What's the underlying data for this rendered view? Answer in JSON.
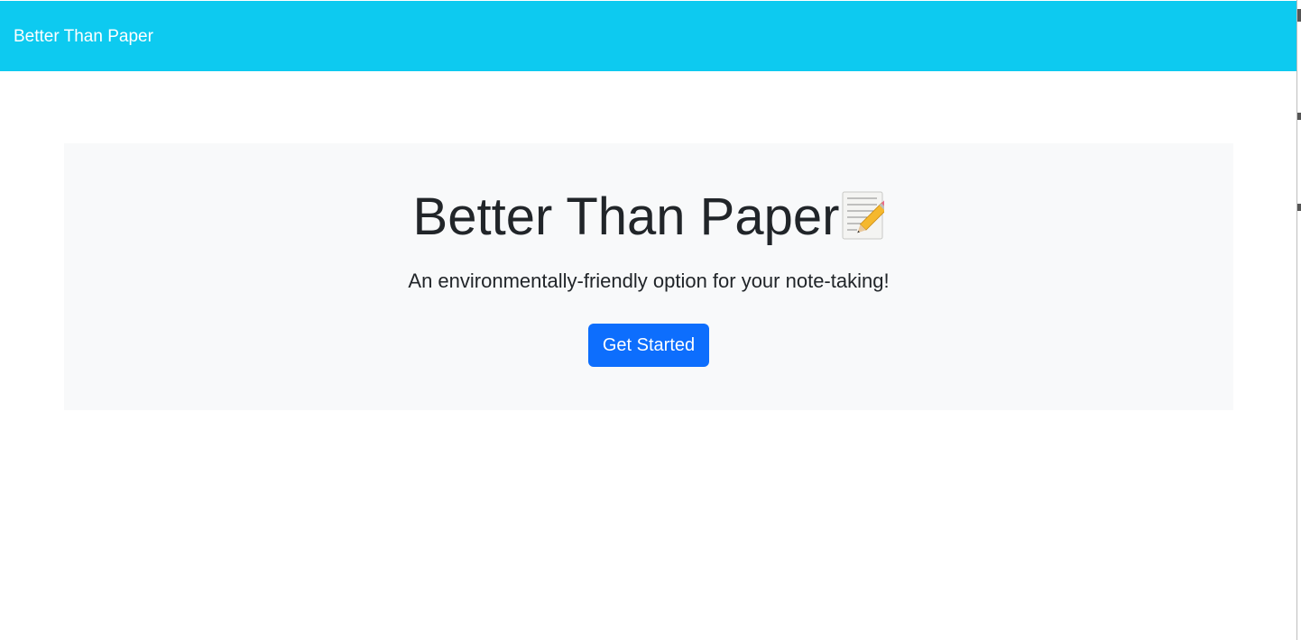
{
  "navbar": {
    "brand": "Better Than Paper",
    "background_color": "#0dcaf0"
  },
  "hero": {
    "title": "Better Than Paper",
    "title_icon": "notepad-pencil-icon",
    "subtitle": "An environmentally-friendly option for your note-taking!",
    "button_label": "Get Started",
    "button_color": "#0d6efd",
    "background_color": "#f8f9fa"
  }
}
